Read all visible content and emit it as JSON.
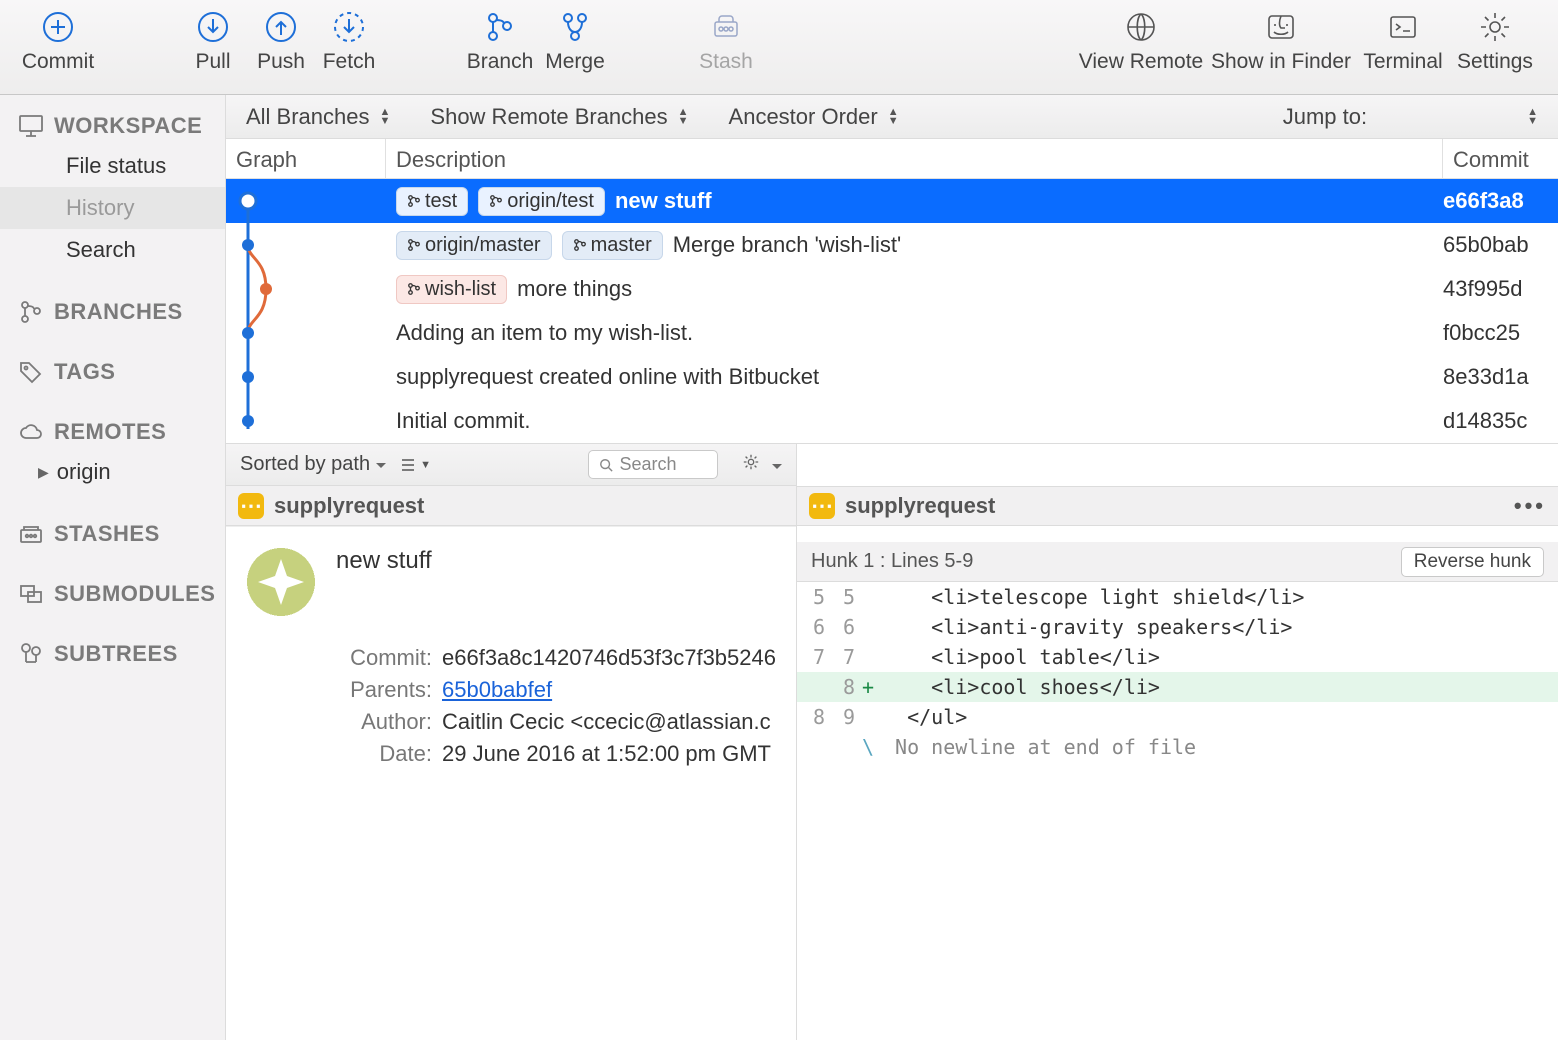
{
  "toolbar": {
    "commit": "Commit",
    "pull": "Pull",
    "push": "Push",
    "fetch": "Fetch",
    "branch": "Branch",
    "merge": "Merge",
    "stash": "Stash",
    "view_remote": "View Remote",
    "show_in_finder": "Show in Finder",
    "terminal": "Terminal",
    "settings": "Settings"
  },
  "sidebar": {
    "workspace": {
      "title": "WORKSPACE",
      "file_status": "File status",
      "history": "History",
      "search": "Search"
    },
    "branches": {
      "title": "BRANCHES"
    },
    "tags": {
      "title": "TAGS"
    },
    "remotes": {
      "title": "REMOTES",
      "origin": "origin"
    },
    "stashes": {
      "title": "STASHES"
    },
    "submodules": {
      "title": "SUBMODULES"
    },
    "subtrees": {
      "title": "SUBTREES"
    }
  },
  "filters": {
    "branches": "All Branches",
    "remote": "Show Remote Branches",
    "order": "Ancestor Order",
    "jump": "Jump to:"
  },
  "columns": {
    "graph": "Graph",
    "description": "Description",
    "commit": "Commit"
  },
  "history": [
    {
      "tags": [
        "test",
        "origin/test"
      ],
      "tag_style": "blue",
      "msg": "new stuff",
      "hash": "e66f3a8",
      "selected": true
    },
    {
      "tags": [
        "origin/master",
        "master"
      ],
      "tag_style": "blue",
      "msg": "Merge branch 'wish-list'",
      "hash": "65b0bab"
    },
    {
      "tags": [
        "wish-list"
      ],
      "tag_style": "pink",
      "msg": "more things",
      "hash": "43f995d"
    },
    {
      "tags": [],
      "msg": "Adding an item to my wish-list.",
      "hash": "f0bcc25"
    },
    {
      "tags": [],
      "msg": "supplyrequest created online with Bitbucket",
      "hash": "8e33d1a"
    },
    {
      "tags": [],
      "msg": "Initial commit.",
      "hash": "d14835c"
    }
  ],
  "bottom_toolbar": {
    "sort": "Sorted by path",
    "search_placeholder": "Search"
  },
  "file": {
    "name_left": "supplyrequest",
    "name_right": "supplyrequest"
  },
  "commit_detail": {
    "title": "new stuff",
    "commit_label": "Commit:",
    "commit_value": "e66f3a8c1420746d53f3c7f3b5246",
    "parents_label": "Parents:",
    "parents_value": "65b0babfef",
    "author_label": "Author:",
    "author_value": "Caitlin Cecic <ccecic@atlassian.c",
    "date_label": "Date:",
    "date_value": "29 June 2016 at 1:52:00 pm GMT"
  },
  "hunk": {
    "header": "Hunk 1 : Lines 5-9",
    "reverse": "Reverse hunk",
    "lines": [
      {
        "a": "5",
        "b": "5",
        "m": " ",
        "code": "    <li>telescope light shield</li>"
      },
      {
        "a": "6",
        "b": "6",
        "m": " ",
        "code": "    <li>anti-gravity speakers</li>"
      },
      {
        "a": "7",
        "b": "7",
        "m": " ",
        "code": "    <li>pool table</li>"
      },
      {
        "a": "",
        "b": "8",
        "m": "+",
        "code": "    <li>cool shoes</li>",
        "class": "added"
      },
      {
        "a": "8",
        "b": "9",
        "m": " ",
        "code": "  </ul>"
      },
      {
        "a": "",
        "b": "",
        "m": "\\",
        "code": " No newline at end of file",
        "class": "meta"
      }
    ]
  }
}
